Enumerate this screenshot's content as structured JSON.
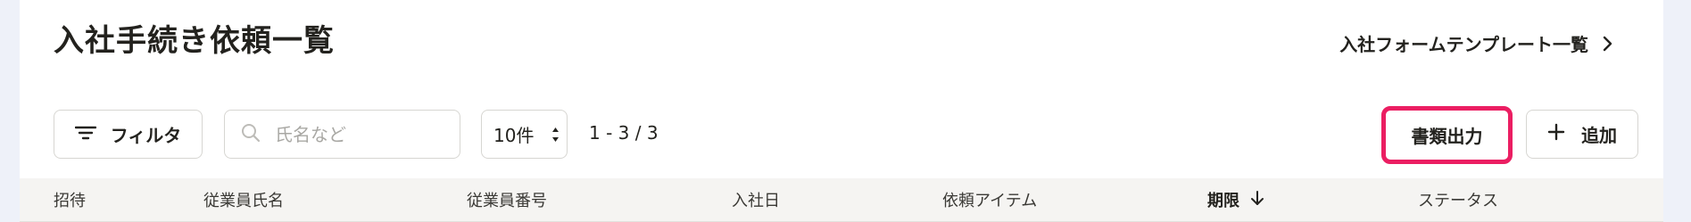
{
  "header": {
    "title": "入社手続き依頼一覧",
    "template_link": "入社フォームテンプレート一覧"
  },
  "toolbar": {
    "filter_label": "フィルタ",
    "search_placeholder": "氏名など",
    "per_page": "10件",
    "pagination": "1 - 3 / 3",
    "export_label": "書類出力",
    "add_label": "追加"
  },
  "table": {
    "columns": [
      {
        "label": "招待"
      },
      {
        "label": "従業員氏名"
      },
      {
        "label": "従業員番号"
      },
      {
        "label": "入社日"
      },
      {
        "label": "依頼アイテム"
      },
      {
        "label": "期限",
        "sorted": "desc"
      },
      {
        "label": "ステータス"
      }
    ]
  },
  "colors": {
    "highlight_border": "#eb1e62",
    "page_background": "#eef1f9",
    "table_header_bg": "#f5f4f2"
  },
  "icons": [
    "filter-icon",
    "search-icon",
    "select-arrows-icon",
    "chevron-right-icon",
    "plus-icon",
    "arrow-down-icon"
  ]
}
